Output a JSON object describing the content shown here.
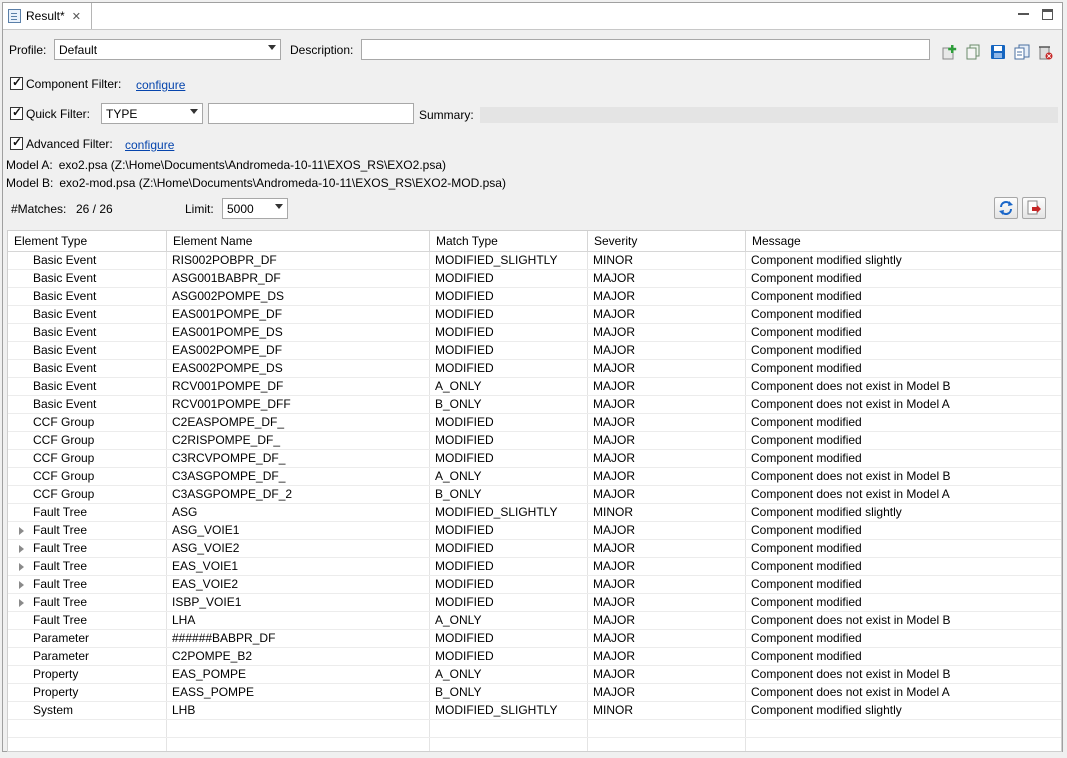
{
  "tab": {
    "title": "Result*",
    "close_glyph": "✕"
  },
  "profile": {
    "label": "Profile:",
    "value": "Default"
  },
  "description": {
    "label": "Description:",
    "value": ""
  },
  "component_filter": {
    "label": "Component Filter:",
    "link": "configure",
    "checked": true
  },
  "quick_filter": {
    "label": "Quick Filter:",
    "type_value": "TYPE",
    "text_value": "",
    "checked": true
  },
  "summary": {
    "label": "Summary:"
  },
  "advanced_filter": {
    "label": "Advanced Filter:",
    "link": "configure",
    "checked": true
  },
  "model_a": {
    "label": "Model A:",
    "value": "exo2.psa (Z:\\Home\\Documents\\Andromeda-10-11\\EXOS_RS\\EXO2.psa)"
  },
  "model_b": {
    "label": "Model B:",
    "value": "exo2-mod.psa (Z:\\Home\\Documents\\Andromeda-10-11\\EXOS_RS\\EXO2-MOD.psa)"
  },
  "matches": {
    "label": "#Matches:",
    "value": "26 / 26"
  },
  "limit": {
    "label": "Limit:",
    "value": "5000"
  },
  "toolbar_icons": [
    "add-profile-icon",
    "copy-profile-icon",
    "save-icon",
    "export-icon",
    "delete-icon"
  ],
  "colors": {
    "link": "#0645ad",
    "save_icon": "#1565c0",
    "refresh_icon": "#1a66c8",
    "export_icon": "#c62828"
  },
  "table": {
    "columns": [
      "Element Type",
      "Element Name",
      "Match Type",
      "Severity",
      "Message"
    ],
    "rows": [
      {
        "type": "Basic Event",
        "name": "RIS002POBPR_DF",
        "match": "MODIFIED_SLIGHTLY",
        "severity": "MINOR",
        "message": "Component modified slightly",
        "expandable": false
      },
      {
        "type": "Basic Event",
        "name": "ASG001BABPR_DF",
        "match": "MODIFIED",
        "severity": "MAJOR",
        "message": "Component modified",
        "expandable": false
      },
      {
        "type": "Basic Event",
        "name": "ASG002POMPE_DS",
        "match": "MODIFIED",
        "severity": "MAJOR",
        "message": "Component modified",
        "expandable": false
      },
      {
        "type": "Basic Event",
        "name": "EAS001POMPE_DF",
        "match": "MODIFIED",
        "severity": "MAJOR",
        "message": "Component modified",
        "expandable": false
      },
      {
        "type": "Basic Event",
        "name": "EAS001POMPE_DS",
        "match": "MODIFIED",
        "severity": "MAJOR",
        "message": "Component modified",
        "expandable": false
      },
      {
        "type": "Basic Event",
        "name": "EAS002POMPE_DF",
        "match": "MODIFIED",
        "severity": "MAJOR",
        "message": "Component modified",
        "expandable": false
      },
      {
        "type": "Basic Event",
        "name": "EAS002POMPE_DS",
        "match": "MODIFIED",
        "severity": "MAJOR",
        "message": "Component modified",
        "expandable": false
      },
      {
        "type": "Basic Event",
        "name": "RCV001POMPE_DF",
        "match": "A_ONLY",
        "severity": "MAJOR",
        "message": "Component does not exist in Model B",
        "expandable": false
      },
      {
        "type": "Basic Event",
        "name": "RCV001POMPE_DFF",
        "match": "B_ONLY",
        "severity": "MAJOR",
        "message": "Component does not exist in Model A",
        "expandable": false
      },
      {
        "type": "CCF Group",
        "name": "C2EASPOMPE_DF_",
        "match": "MODIFIED",
        "severity": "MAJOR",
        "message": "Component modified",
        "expandable": false
      },
      {
        "type": "CCF Group",
        "name": "C2RISPOMPE_DF_",
        "match": "MODIFIED",
        "severity": "MAJOR",
        "message": "Component modified",
        "expandable": false
      },
      {
        "type": "CCF Group",
        "name": "C3RCVPOMPE_DF_",
        "match": "MODIFIED",
        "severity": "MAJOR",
        "message": "Component modified",
        "expandable": false
      },
      {
        "type": "CCF Group",
        "name": "C3ASGPOMPE_DF_",
        "match": "A_ONLY",
        "severity": "MAJOR",
        "message": "Component does not exist in Model B",
        "expandable": false
      },
      {
        "type": "CCF Group",
        "name": "C3ASGPOMPE_DF_2",
        "match": "B_ONLY",
        "severity": "MAJOR",
        "message": "Component does not exist in Model A",
        "expandable": false
      },
      {
        "type": "Fault Tree",
        "name": "ASG",
        "match": "MODIFIED_SLIGHTLY",
        "severity": "MINOR",
        "message": "Component modified slightly",
        "expandable": false
      },
      {
        "type": "Fault Tree",
        "name": "ASG_VOIE1",
        "match": "MODIFIED",
        "severity": "MAJOR",
        "message": "Component modified",
        "expandable": true
      },
      {
        "type": "Fault Tree",
        "name": "ASG_VOIE2",
        "match": "MODIFIED",
        "severity": "MAJOR",
        "message": "Component modified",
        "expandable": true
      },
      {
        "type": "Fault Tree",
        "name": "EAS_VOIE1",
        "match": "MODIFIED",
        "severity": "MAJOR",
        "message": "Component modified",
        "expandable": true
      },
      {
        "type": "Fault Tree",
        "name": "EAS_VOIE2",
        "match": "MODIFIED",
        "severity": "MAJOR",
        "message": "Component modified",
        "expandable": true
      },
      {
        "type": "Fault Tree",
        "name": "ISBP_VOIE1",
        "match": "MODIFIED",
        "severity": "MAJOR",
        "message": "Component modified",
        "expandable": true
      },
      {
        "type": "Fault Tree",
        "name": "LHA",
        "match": "A_ONLY",
        "severity": "MAJOR",
        "message": "Component does not exist in Model B",
        "expandable": false
      },
      {
        "type": "Parameter",
        "name": "######BABPR_DF",
        "match": "MODIFIED",
        "severity": "MAJOR",
        "message": "Component modified",
        "expandable": false
      },
      {
        "type": "Parameter",
        "name": "C2POMPE_B2",
        "match": "MODIFIED",
        "severity": "MAJOR",
        "message": "Component modified",
        "expandable": false
      },
      {
        "type": "Property",
        "name": "EAS_POMPE",
        "match": "A_ONLY",
        "severity": "MAJOR",
        "message": "Component does not exist in Model B",
        "expandable": false
      },
      {
        "type": "Property",
        "name": "EASS_POMPE",
        "match": "B_ONLY",
        "severity": "MAJOR",
        "message": "Component does not exist in Model A",
        "expandable": false
      },
      {
        "type": "System",
        "name": "LHB",
        "match": "MODIFIED_SLIGHTLY",
        "severity": "MINOR",
        "message": "Component modified slightly",
        "expandable": false
      }
    ]
  }
}
